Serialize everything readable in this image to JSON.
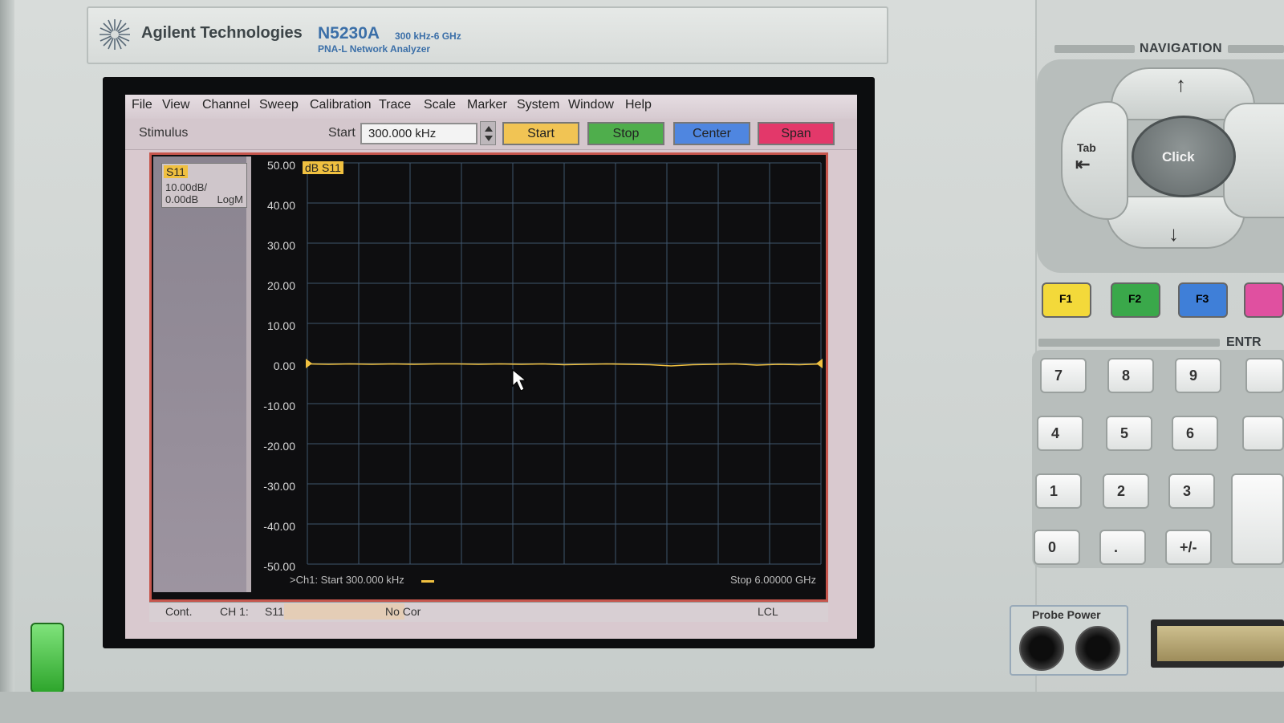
{
  "brand": {
    "name": "Agilent Technologies",
    "model": "N5230A",
    "range": "300 kHz-6 GHz",
    "subtitle": "PNA-L Network Analyzer"
  },
  "menu": [
    "File",
    "View",
    "Channel",
    "Sweep",
    "Calibration",
    "Trace",
    "Scale",
    "Marker",
    "System",
    "Window",
    "Help"
  ],
  "toolbar": {
    "stimulus_label": "Stimulus",
    "start_label": "Start",
    "start_value": "300.000 kHz",
    "buttons": [
      "Start",
      "Stop",
      "Center",
      "Span"
    ],
    "button_colors": [
      "#f1c454",
      "#4fae4c",
      "#4f86e0",
      "#e3386a"
    ]
  },
  "trace_info": {
    "id": "S11",
    "scale": "10.00dB/",
    "ref": "0.00dB",
    "format": "LogM",
    "tag": "dB S11"
  },
  "chart_data": {
    "type": "line",
    "series": [
      {
        "name": "dB S11",
        "color": "#f0c040",
        "x": [
          0.0003,
          0.25,
          0.5,
          0.75,
          1.0,
          1.25,
          1.5,
          1.75,
          2.0,
          2.25,
          2.5,
          2.75,
          3.0,
          3.25,
          3.5,
          3.75,
          4.0,
          4.25,
          4.5,
          4.75,
          5.0,
          5.25,
          5.5,
          5.75,
          6.0
        ],
        "values": [
          -0.1,
          -0.2,
          -0.1,
          -0.2,
          -0.1,
          -0.2,
          -0.1,
          -0.1,
          -0.2,
          -0.1,
          -0.2,
          -0.1,
          -0.3,
          -0.2,
          -0.1,
          -0.2,
          -0.3,
          -0.6,
          -0.3,
          -0.2,
          -0.1,
          -0.4,
          -0.2,
          -0.3,
          -0.1
        ]
      }
    ],
    "y_ticks": [
      "50.00",
      "40.00",
      "30.00",
      "20.00",
      "10.00",
      "0.00",
      "-10.00",
      "-20.00",
      "-30.00",
      "-40.00",
      "-50.00"
    ],
    "ylim": [
      -50,
      50
    ],
    "xlim": [
      0.0003,
      6.0
    ],
    "x_divisions": 10,
    "y_divisions": 10,
    "grid": true,
    "start_label": ">Ch1: Start  300.000 kHz",
    "stop_label": "Stop  6.00000 GHz"
  },
  "status": {
    "mode": "Cont.",
    "channel": "CH 1:",
    "param": "S11",
    "correction": "No Cor",
    "remote": "LCL"
  },
  "hardware": {
    "navigation_title": "NAVIGATION",
    "tab_label": "Tab",
    "click_label": "Click",
    "fkeys": [
      "F1",
      "F2",
      "F3"
    ],
    "fkey_colors": [
      "#f3d93a",
      "#3aa84a",
      "#3f7fd8",
      "#e050a0"
    ],
    "entry_title": "ENTR",
    "keys": [
      "7",
      "8",
      "9",
      "4",
      "5",
      "6",
      "1",
      "2",
      "3",
      "0",
      ".",
      "+/-"
    ],
    "probe_power": "Probe Power"
  }
}
